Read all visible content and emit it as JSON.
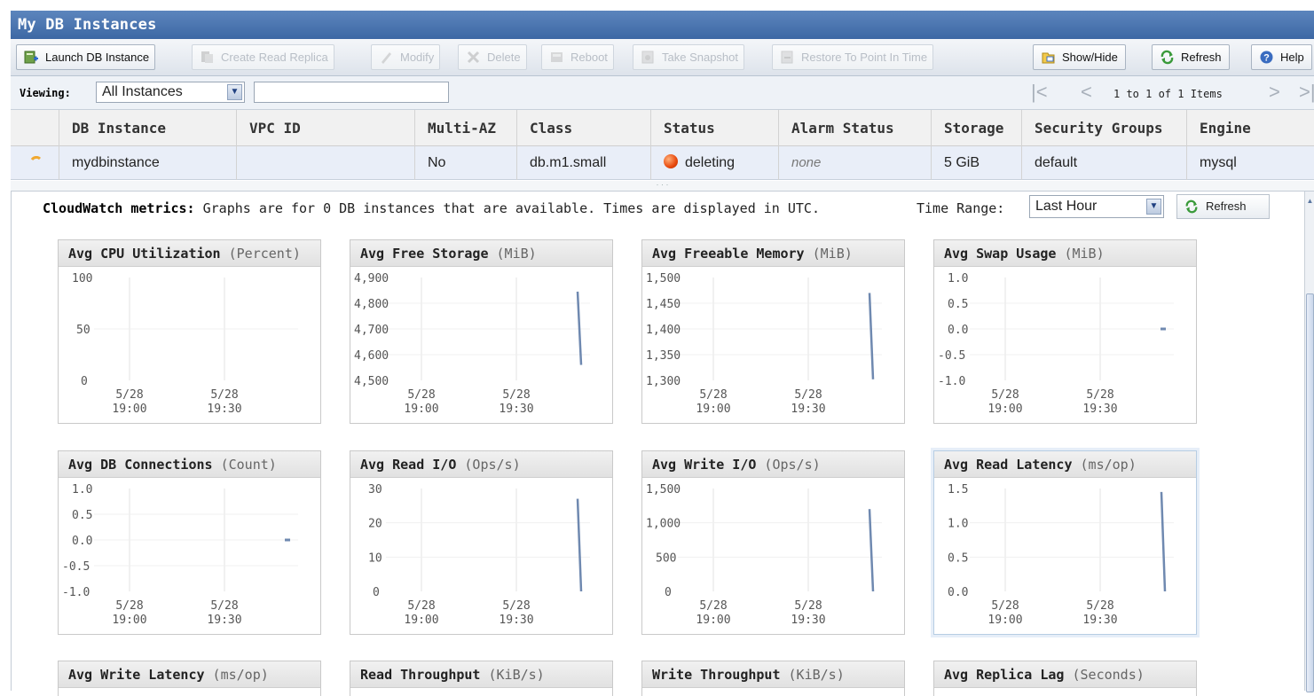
{
  "window": {
    "title": "My DB Instances"
  },
  "toolbar": {
    "buttons": [
      {
        "label": "Launch DB Instance",
        "enabled": true,
        "icon": "launch-icon"
      },
      {
        "label": "Create Read Replica",
        "enabled": false,
        "icon": "replica-icon"
      },
      {
        "label": "Modify",
        "enabled": false,
        "icon": "modify-icon"
      },
      {
        "label": "Delete",
        "enabled": false,
        "icon": "delete-icon"
      },
      {
        "label": "Reboot",
        "enabled": false,
        "icon": "reboot-icon"
      },
      {
        "label": "Take Snapshot",
        "enabled": false,
        "icon": "snapshot-icon"
      },
      {
        "label": "Restore To Point In Time",
        "enabled": false,
        "icon": "restore-icon"
      }
    ],
    "show_hide_label": "Show/Hide",
    "refresh_label": "Refresh",
    "help_label": "Help"
  },
  "viewing": {
    "label": "Viewing:",
    "selected": "All Instances",
    "filter_value": "",
    "pagination": "1 to 1 of 1 Items"
  },
  "table": {
    "columns": [
      "DB Instance",
      "VPC ID",
      "Multi-AZ",
      "Class",
      "Status",
      "Alarm Status",
      "Storage",
      "Security Groups",
      "Engine"
    ],
    "rows": [
      {
        "db_instance": "mydbinstance",
        "vpc_id": "",
        "multi_az": "No",
        "class": "db.m1.small",
        "status": "deleting",
        "alarm_status": "none",
        "storage": "5 GiB",
        "security_groups": "default",
        "engine": "mysql"
      }
    ]
  },
  "cloudwatch": {
    "label": "CloudWatch metrics:",
    "text": "Graphs are for 0 DB instances that are available. Times are displayed in UTC.",
    "time_range_label": "Time Range:",
    "time_range_value": "Last Hour",
    "refresh_label": "Refresh"
  },
  "x_ticks": [
    {
      "date": "5/28",
      "time": "19:00"
    },
    {
      "date": "5/28",
      "time": "19:30"
    }
  ],
  "metrics": [
    {
      "title": "Avg CPU Utilization",
      "unit": "(Percent)",
      "yticks": [
        "100",
        "50",
        "0"
      ],
      "ymin": 0,
      "ymax": 100,
      "series": []
    },
    {
      "title": "Avg Free Storage",
      "unit": "(MiB)",
      "yticks": [
        "4,900",
        "4,800",
        "4,700",
        "4,600",
        "4,500"
      ],
      "ymin": 4500,
      "ymax": 4900,
      "series": [
        {
          "from": 4845,
          "to": 4560
        }
      ]
    },
    {
      "title": "Avg Freeable Memory",
      "unit": "(MiB)",
      "yticks": [
        "1,500",
        "1,450",
        "1,400",
        "1,350",
        "1,300"
      ],
      "ymin": 1300,
      "ymax": 1500,
      "series": [
        {
          "from": 1470,
          "to": 1302
        }
      ]
    },
    {
      "title": "Avg Swap Usage",
      "unit": "(MiB)",
      "yticks": [
        "1.0",
        "0.5",
        "0.0",
        "-0.5",
        "-1.0"
      ],
      "ymin": -1,
      "ymax": 1,
      "series": [
        {
          "from": 0,
          "to": 0,
          "point": true
        }
      ]
    },
    {
      "title": "Avg DB Connections",
      "unit": "(Count)",
      "yticks": [
        "1.0",
        "0.5",
        "0.0",
        "-0.5",
        "-1.0"
      ],
      "ymin": -1,
      "ymax": 1,
      "series": [
        {
          "from": 0,
          "to": 0,
          "point": true
        }
      ]
    },
    {
      "title": "Avg Read I/O",
      "unit": "(Ops/s)",
      "yticks": [
        "30",
        "20",
        "10",
        "0"
      ],
      "ymin": 0,
      "ymax": 30,
      "series": [
        {
          "from": 27,
          "to": 0
        }
      ]
    },
    {
      "title": "Avg Write I/O",
      "unit": "(Ops/s)",
      "yticks": [
        "1,500",
        "1,000",
        "500",
        "0"
      ],
      "ymin": 0,
      "ymax": 1500,
      "series": [
        {
          "from": 1200,
          "to": 0
        }
      ]
    },
    {
      "title": "Avg Read Latency",
      "unit": "(ms/op)",
      "yticks": [
        "1.5",
        "1.0",
        "0.5",
        "0.0"
      ],
      "ymin": 0,
      "ymax": 1.5,
      "series": [
        {
          "from": 1.45,
          "to": 0
        }
      ]
    }
  ],
  "partial_metrics": [
    {
      "title": "Avg Write Latency",
      "unit": "(ms/op)"
    },
    {
      "title": "Read Throughput",
      "unit": "(KiB/s)"
    },
    {
      "title": "Write Throughput",
      "unit": "(KiB/s)"
    },
    {
      "title": "Avg Replica Lag",
      "unit": "(Seconds)"
    }
  ],
  "colors": {
    "series": "#6f89b0",
    "grid": "#e3e3e3",
    "status_deleting": "#e8480c"
  }
}
